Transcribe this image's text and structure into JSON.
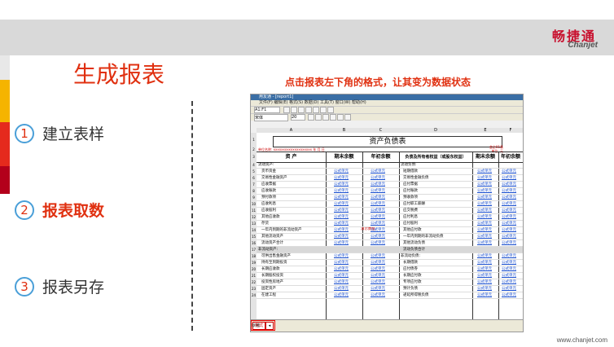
{
  "brand": {
    "cn": "畅捷通",
    "en": "Chanjet"
  },
  "colors": {
    "accent": "#e03010",
    "strips": [
      "#e8e8e8",
      "#f5b400",
      "#e52a1d",
      "#b3001b"
    ]
  },
  "title": "生成报表",
  "steps": [
    {
      "num": "1",
      "label": "建立表样"
    },
    {
      "num": "2",
      "label": "报表取数"
    },
    {
      "num": "3",
      "label": "报表另存"
    }
  ],
  "hint": "点击报表左下角的格式，让其变为数据状态",
  "screenshot": {
    "window_title": "用友通 - [report1]",
    "menu": "文件(F)  编辑(E)  格式(S)  数据(D)  工具(T)  窗口(W)  帮助(H)",
    "cell_ref": "A1:F1",
    "font_name": "宋体",
    "font_size": "20",
    "columns": [
      "A",
      "B",
      "C",
      "D",
      "E",
      "F"
    ],
    "sheet_title": "资产负债表",
    "unit_left": "单位名称: xxxxxxxxxxxxxxxxxxxx    年    月    日",
    "unit_right_1": "会企01表",
    "unit_right_2": "单位: 元",
    "headers": [
      "资    产",
      "期末余额",
      "年初余额",
      "负债及所有者权益（或股东权益）",
      "期末余额",
      "年初余额"
    ],
    "rows": [
      {
        "n": "4",
        "a": "流动资产:",
        "d": "流动负债:",
        "f": false
      },
      {
        "n": "5",
        "a": "货币资金",
        "d": "短期借款",
        "f": true
      },
      {
        "n": "6",
        "a": "交易性金融资产",
        "d": "交易性金融负债",
        "f": true
      },
      {
        "n": "7",
        "a": "应收票据",
        "d": "应付票据",
        "f": true
      },
      {
        "n": "8",
        "a": "应收账款",
        "d": "应付账款",
        "f": true
      },
      {
        "n": "9",
        "a": "预付款项",
        "d": "预收款项",
        "f": true
      },
      {
        "n": "10",
        "a": "应收利息",
        "d": "应付职工薪酬",
        "f": true
      },
      {
        "n": "11",
        "a": "应收股利",
        "d": "应交税费",
        "f": true
      },
      {
        "n": "12",
        "a": "其他应收款",
        "d": "应付利息",
        "f": true
      },
      {
        "n": "13",
        "a": "存货",
        "d": "应付股利",
        "f": true
      },
      {
        "n": "14",
        "a": "一年内到期的非流动资产",
        "d": "其他应付款",
        "f": true
      },
      {
        "n": "15",
        "a": "其他流动资产",
        "d": "一年内到期的非流动负债",
        "f": true
      },
      {
        "n": "16",
        "a": "流动资产合计",
        "d": "其他流动负债",
        "f": true
      },
      {
        "n": "17",
        "a": "非流动资产:",
        "d": "流动负债合计",
        "f": false,
        "shade": true
      },
      {
        "n": "18",
        "a": "可供出售金融资产",
        "d": "非流动负债:",
        "f": true
      },
      {
        "n": "19",
        "a": "持有至到期投资",
        "d": "长期借款",
        "f": true
      },
      {
        "n": "20",
        "a": "长期应收款",
        "d": "应付债券",
        "f": true
      },
      {
        "n": "21",
        "a": "长期股权投资",
        "d": "长期应付款",
        "f": true
      },
      {
        "n": "22",
        "a": "投资性房地产",
        "d": "专项应付款",
        "f": true
      },
      {
        "n": "23",
        "a": "固定资产",
        "d": "预计负债",
        "f": true
      },
      {
        "n": "24",
        "a": "在建工程",
        "d": "递延所得税负债",
        "f": true
      }
    ],
    "formula_text": "公式单元",
    "demo_text": "演示数据",
    "status": {
      "format_label": "格式",
      "arrow": "◂",
      "footer": "就绪"
    }
  },
  "url": "www.chanjet.com"
}
